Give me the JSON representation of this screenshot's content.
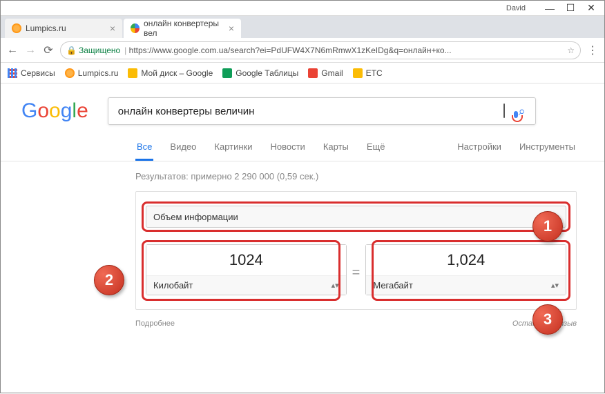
{
  "window": {
    "user": "David"
  },
  "tabs": [
    {
      "title": "Lumpics.ru"
    },
    {
      "title": "онлайн конвертеры вел"
    }
  ],
  "addr": {
    "secure": "Защищено",
    "url": "https://www.google.com.ua/search?ei=PdUFW4X7N6mRmwX1zKeIDg&q=онлайн+ко..."
  },
  "bookmarks": {
    "services": "Сервисы",
    "lumpics": "Lumpics.ru",
    "drive": "Мой диск – Google",
    "sheets": "Google Таблицы",
    "gmail": "Gmail",
    "etc": "ETC"
  },
  "search": {
    "query": "онлайн конвертеры величин"
  },
  "nav": {
    "all": "Все",
    "video": "Видео",
    "images": "Картинки",
    "news": "Новости",
    "maps": "Карты",
    "more": "Ещё",
    "settings": "Настройки",
    "tools": "Инструменты"
  },
  "results_text": "Результатов: примерно 2 290 000 (0,59 сек.)",
  "converter": {
    "category": "Объем информации",
    "left_value": "1024",
    "left_unit": "Килобайт",
    "right_value": "1,024",
    "right_unit": "Мегабайт"
  },
  "footer": {
    "more": "Подробнее",
    "feedback": "Оставить отзыв"
  },
  "bubbles": {
    "one": "1",
    "two": "2",
    "three": "3"
  }
}
